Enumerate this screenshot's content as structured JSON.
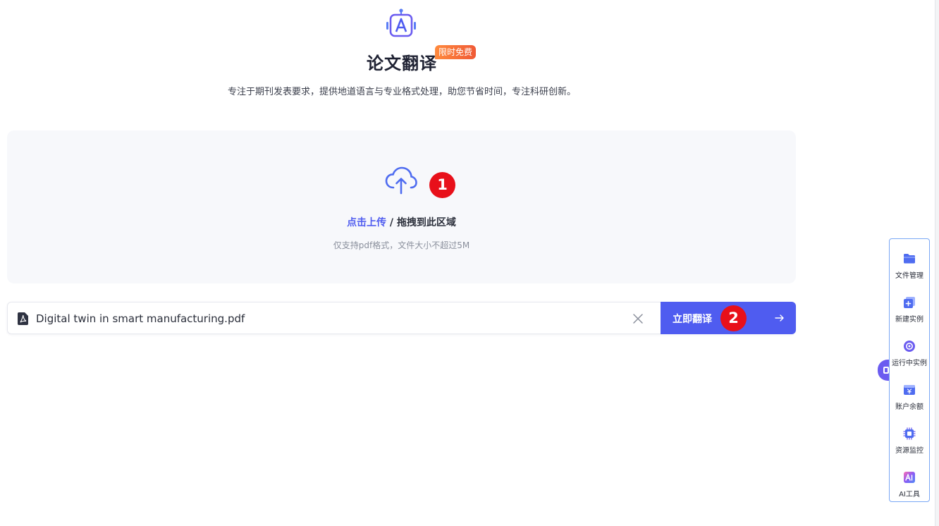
{
  "header": {
    "title": "论文翻译",
    "badge": "限时免费",
    "subtitle": "专注于期刊发表要求，提供地道语言与专业格式处理，助您节省时间，专注科研创新。"
  },
  "upload": {
    "link_text": "点击上传",
    "separator": " / ",
    "drag_text": "拖拽到此区域",
    "hint": "仅支持pdf格式，文件大小不超过5M",
    "marker": "1"
  },
  "file": {
    "name": "Digital twin in smart manufacturing.pdf",
    "translate_label": "立即翻译",
    "marker": "2"
  },
  "sidebar": {
    "items": [
      {
        "label": "文件管理",
        "icon": "folder-icon"
      },
      {
        "label": "新建实例",
        "icon": "new-instance-icon"
      },
      {
        "label": "运行中实例",
        "icon": "running-instance-icon"
      },
      {
        "label": "账户余额",
        "icon": "wallet-icon"
      },
      {
        "label": "资源监控",
        "icon": "chip-icon"
      },
      {
        "label": "AI工具",
        "icon": "ai-tools-icon"
      }
    ]
  },
  "colors": {
    "primary": "#4f5cf0",
    "badge": "#f05a36",
    "marker": "#e8101a"
  }
}
